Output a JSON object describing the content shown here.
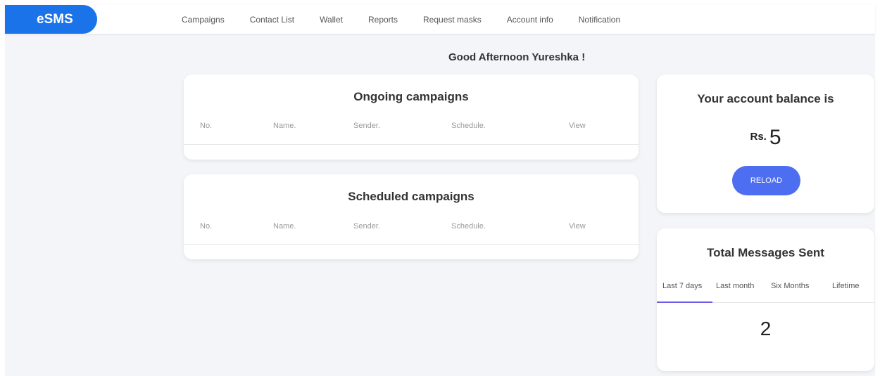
{
  "header": {
    "logo": "eSMS",
    "nav": [
      "Campaigns",
      "Contact List",
      "Wallet",
      "Reports",
      "Request masks",
      "Account info",
      "Notification"
    ]
  },
  "greeting": "Good Afternoon Yureshka !",
  "ongoing": {
    "title": "Ongoing campaigns",
    "columns": [
      "No.",
      "Name.",
      "Sender.",
      "Schedule.",
      "View"
    ]
  },
  "scheduled": {
    "title": "Scheduled campaigns",
    "columns": [
      "No.",
      "Name.",
      "Sender.",
      "Schedule.",
      "View"
    ]
  },
  "balance": {
    "title": "Your account balance is",
    "currency": "Rs.",
    "amount": "5",
    "reload_label": "RELOAD"
  },
  "messages": {
    "title": "Total Messages Sent",
    "tabs": [
      "Last 7 days",
      "Last month",
      "Six Months",
      "Lifetime"
    ],
    "active_tab": "Last 7 days",
    "value": "2"
  },
  "colors": {
    "logo_bg": "#1a73e8",
    "reload_button": "#4e6ef2",
    "active_tab_underline": "#6c5ce7",
    "page_bg": "#f4f5f8"
  }
}
